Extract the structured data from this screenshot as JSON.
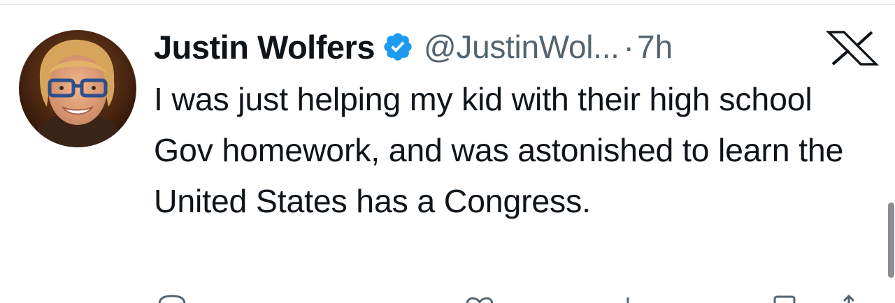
{
  "tweet": {
    "author": {
      "display_name": "Justin Wolfers",
      "handle": "@JustinWol...",
      "verified": true,
      "verified_color": "#1d9bf0"
    },
    "separator": "·",
    "time": "7h",
    "text": "I was just helping my kid with their high school Gov homework, and was astonished to learn the United States has a Congress."
  },
  "brand": {
    "logo_icon": "x-logo-icon"
  },
  "actions": {
    "icons": [
      "reply-icon",
      "like-icon",
      "views-icon",
      "share-icon"
    ]
  },
  "colors": {
    "text_primary": "#0f1419",
    "text_secondary": "#536471",
    "accent": "#1d9bf0"
  }
}
